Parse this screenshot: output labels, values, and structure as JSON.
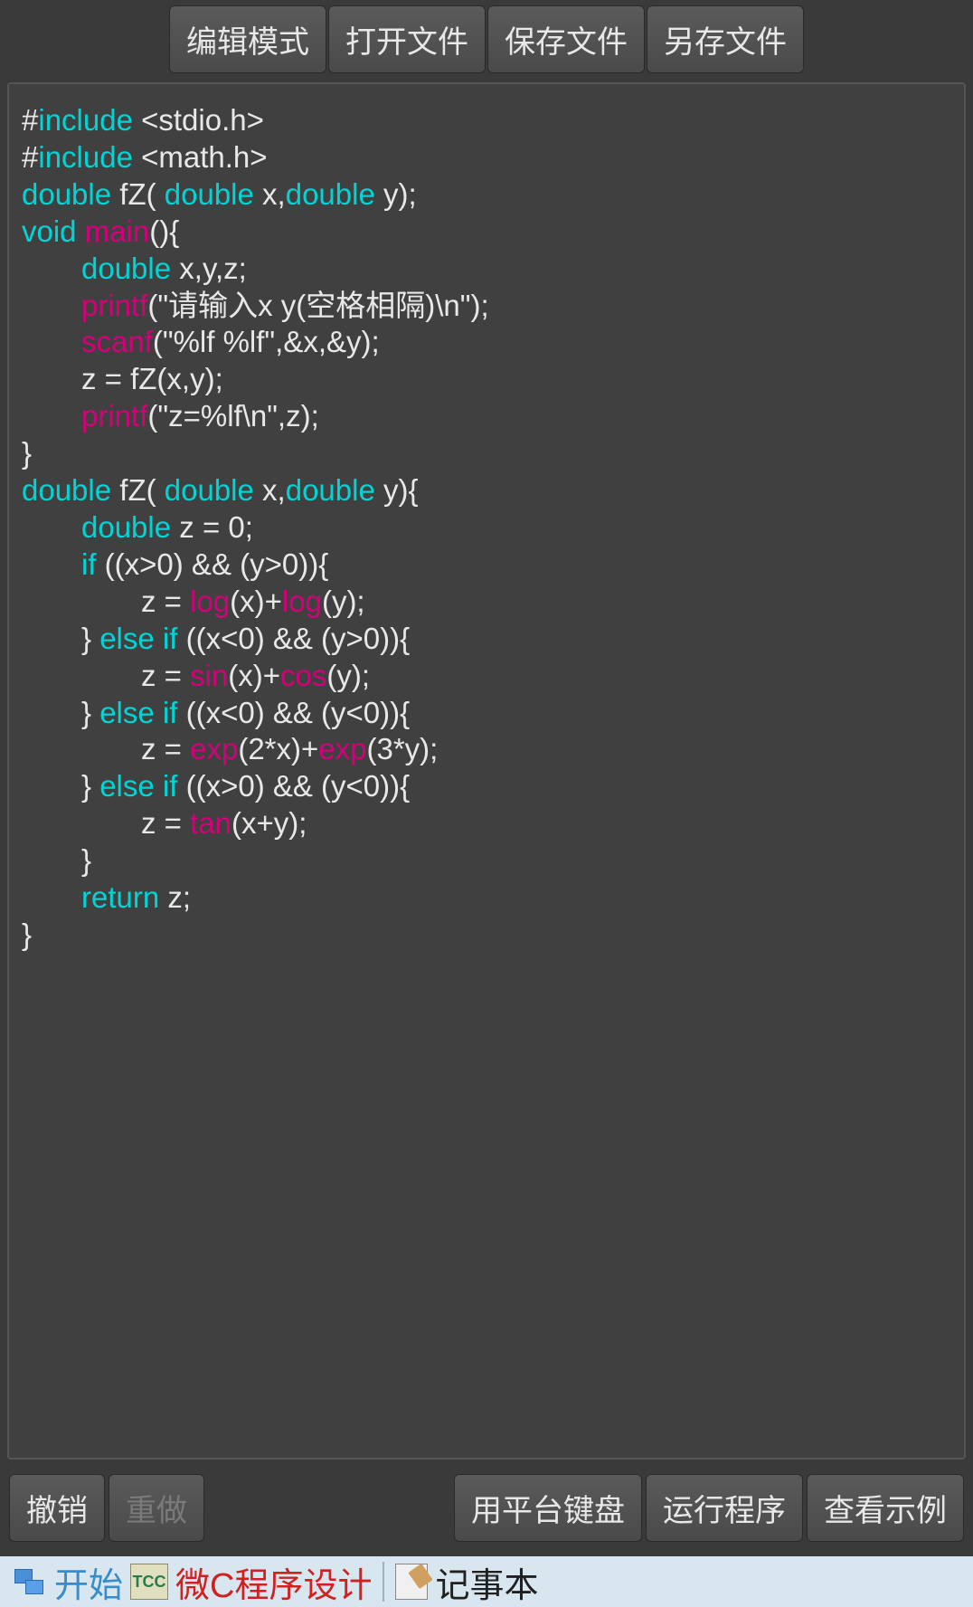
{
  "toolbar": {
    "edit_mode": "编辑模式",
    "open_file": "打开文件",
    "save_file": "保存文件",
    "save_as": "另存文件"
  },
  "code": {
    "l1_pre": "#",
    "l1_kw": "include",
    "l1_rest": " <stdio.h>",
    "l2_pre": "#",
    "l2_kw": "include",
    "l2_rest": " <math.h>",
    "l3_kw1": "double",
    "l3_t1": " fZ( ",
    "l3_kw2": "double",
    "l3_t2": " x,",
    "l3_kw3": "double",
    "l3_t3": " y);",
    "l4_kw": "void",
    "l4_sp": " ",
    "l4_fn": "main",
    "l4_t": "(){",
    "l5_kw": "double",
    "l5_t": " x,y,z;",
    "l6_fn": "printf",
    "l6_t": "(\"请输入x y(空格相隔)\\n\");",
    "l7_fn": "scanf",
    "l7_t": "(\"%lf %lf\",&x,&y);",
    "l8_t": "z = fZ(x,y);",
    "l9_fn": "printf",
    "l9_t": "(\"z=%lf\\n\",z);",
    "l10_t": "}",
    "l11_kw1": "double",
    "l11_t1": " fZ( ",
    "l11_kw2": "double",
    "l11_t2": " x,",
    "l11_kw3": "double",
    "l11_t3": " y){",
    "l12_kw": "double",
    "l12_t": " z = 0;",
    "l13_kw": "if",
    "l13_t": " ((x>0) && (y>0)){",
    "l14_t1": "z = ",
    "l14_fn1": "log",
    "l14_t2": "(x)+",
    "l14_fn2": "log",
    "l14_t3": "(y);",
    "l15_t1": "} ",
    "l15_kw1": "else",
    "l15_sp": " ",
    "l15_kw2": "if",
    "l15_t2": " ((x<0) && (y>0)){",
    "l16_t1": "z = ",
    "l16_fn1": "sin",
    "l16_t2": "(x)+",
    "l16_fn2": "cos",
    "l16_t3": "(y);",
    "l17_t1": "} ",
    "l17_kw1": "else",
    "l17_sp": " ",
    "l17_kw2": "if",
    "l17_t2": " ((x<0) && (y<0)){",
    "l18_t1": "z = ",
    "l18_fn1": "exp",
    "l18_t2": "(2*x)+",
    "l18_fn2": "exp",
    "l18_t3": "(3*y);",
    "l19_t1": "} ",
    "l19_kw1": "else",
    "l19_sp": " ",
    "l19_kw2": "if",
    "l19_t2": " ((x>0) && (y<0)){",
    "l20_t1": "z = ",
    "l20_fn": "tan",
    "l20_t2": "(x+y);",
    "l21_t": "}",
    "l22_kw": "return",
    "l22_t": " z;",
    "l23_t": "}"
  },
  "bottom": {
    "undo": "撤销",
    "redo": "重做",
    "keyboard": "用平台键盘",
    "run": "运行程序",
    "examples": "查看示例"
  },
  "taskbar": {
    "start": "开始",
    "tcc_icon": "TCC",
    "app1": "微C程序设计",
    "app2": "记事本"
  }
}
